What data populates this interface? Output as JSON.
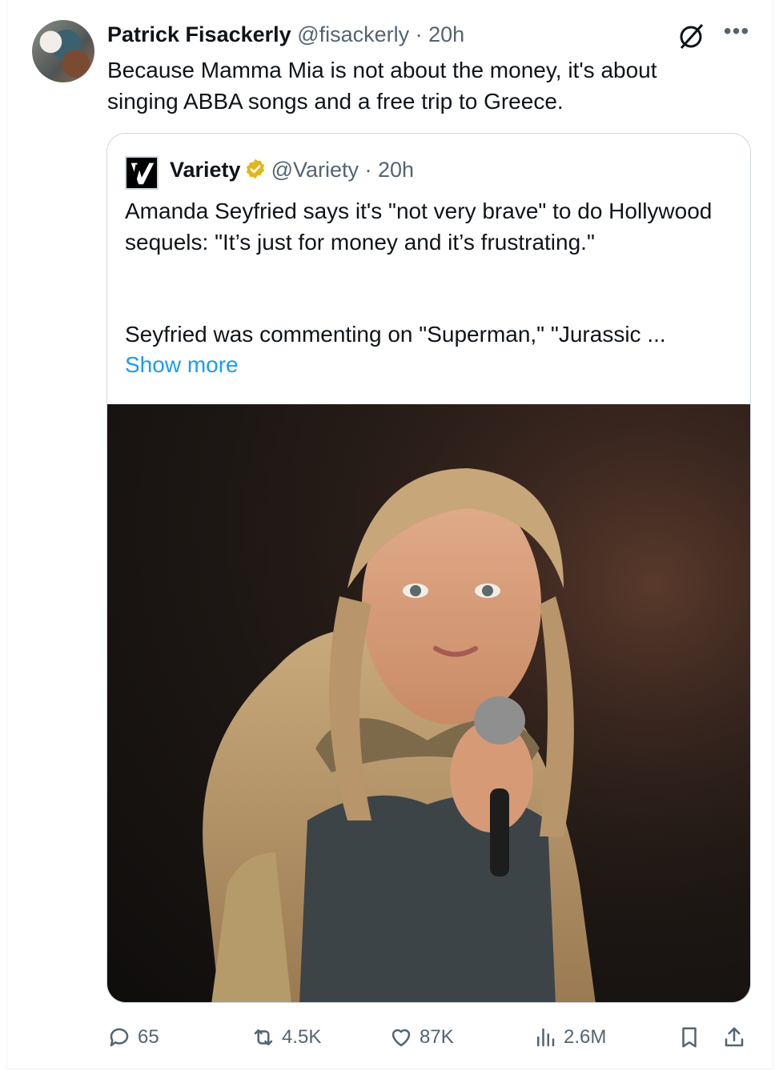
{
  "tweet": {
    "author_name": "Patrick Fisackerly",
    "author_handle_time": "@fisackerly · 20h",
    "text": "Because Mamma Mia is not about the money, it's about singing ABBA songs and a free trip to Greece."
  },
  "quote": {
    "name": "Variety",
    "handle_time": "@Variety · 20h",
    "text": "Amanda Seyfried says it's \"not very brave\" to do Hollywood sequels: \"It’s just for money and it’s frustrating.\"",
    "text2": "Seyfried was commenting on \"Superman,\" \"Jurassic ...",
    "show_more": "Show more"
  },
  "actions": {
    "replies": "65",
    "reposts": "4.5K",
    "likes": "87K",
    "views": "2.6M"
  },
  "colors": {
    "link": "#1d9bf0",
    "secondary": "#536471",
    "verified_gold": "#e2b719"
  }
}
